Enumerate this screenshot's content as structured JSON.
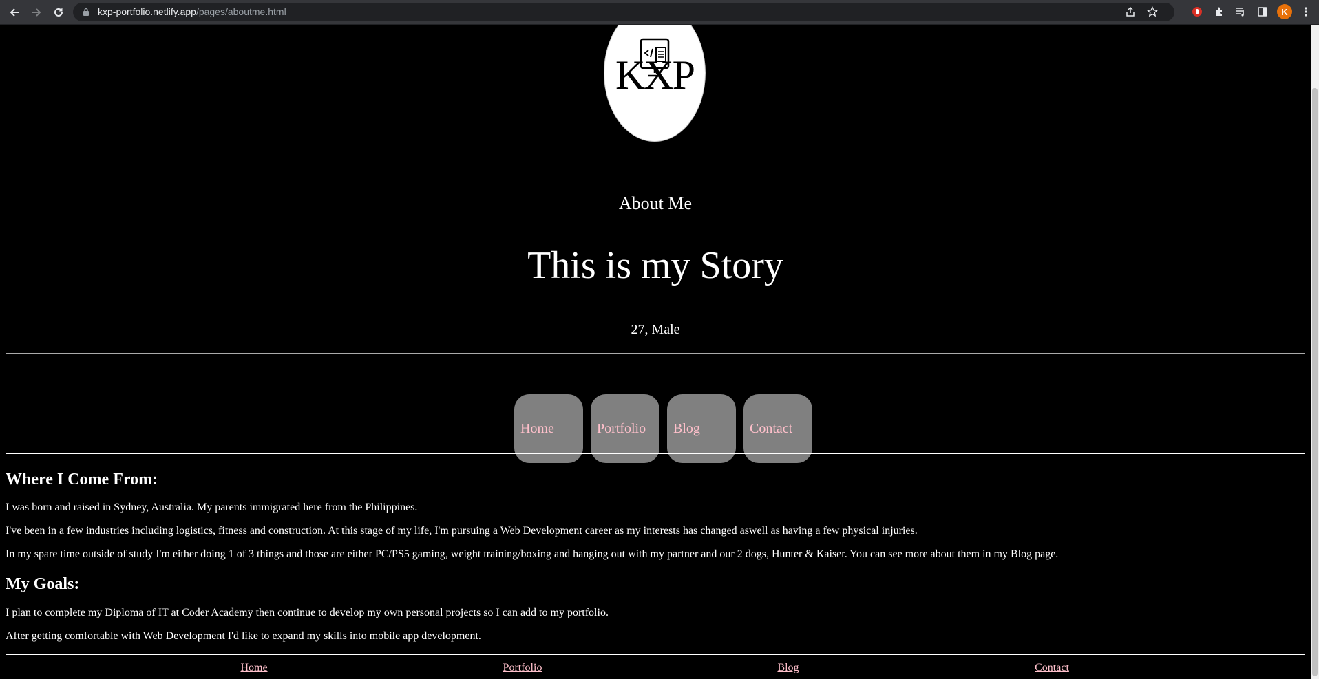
{
  "browser": {
    "url_domain": "kxp-portfolio.netlify.app",
    "url_path": "/pages/aboutme.html",
    "profile_initial": "K",
    "icons": [
      "back-icon",
      "forward-icon",
      "reload-icon",
      "lock-icon",
      "share-icon",
      "star-icon",
      "extension-icon",
      "puzzle-icon",
      "media-icon",
      "sidepanel-icon",
      "menu-icon"
    ]
  },
  "header": {
    "logo_text": "KXP",
    "page_label": "About Me",
    "headline": "This is my Story",
    "subline": "27, Male"
  },
  "nav": {
    "items": [
      {
        "label": "Home"
      },
      {
        "label": "Portfolio"
      },
      {
        "label": "Blog"
      },
      {
        "label": "Contact"
      }
    ]
  },
  "content": {
    "origin_title": "Where I Come From:",
    "origin_paragraphs": [
      "I was born and raised in Sydney, Australia. My parents immigrated here from the Philippines.",
      "I've been in a few industries including logistics, fitness and construction. At this stage of my life, I'm pursuing a Web Development career as my interests has changed aswell as having a few physical injuries.",
      "In my spare time outside of study I'm either doing 1 of 3 things and those are either PC/PS5 gaming, weight training/boxing and hanging out with my partner and our 2 dogs, Hunter & Kaiser. You can see more about them in my Blog page."
    ],
    "goals_title": "My Goals:",
    "goals_paragraphs": [
      "I plan to complete my Diploma of IT at Coder Academy then continue to develop my own personal projects so I can add to my portfolio.",
      "After getting comfortable with Web Development I'd like to expand my skills into mobile app development."
    ]
  },
  "footer": {
    "links": [
      {
        "label": "Home"
      },
      {
        "label": "Portfolio"
      },
      {
        "label": "Blog"
      },
      {
        "label": "Contact"
      }
    ]
  },
  "colors": {
    "page_bg": "#000000",
    "text": "#ffffff",
    "nav_tile": "#808080",
    "link": "#ffc0cb"
  }
}
